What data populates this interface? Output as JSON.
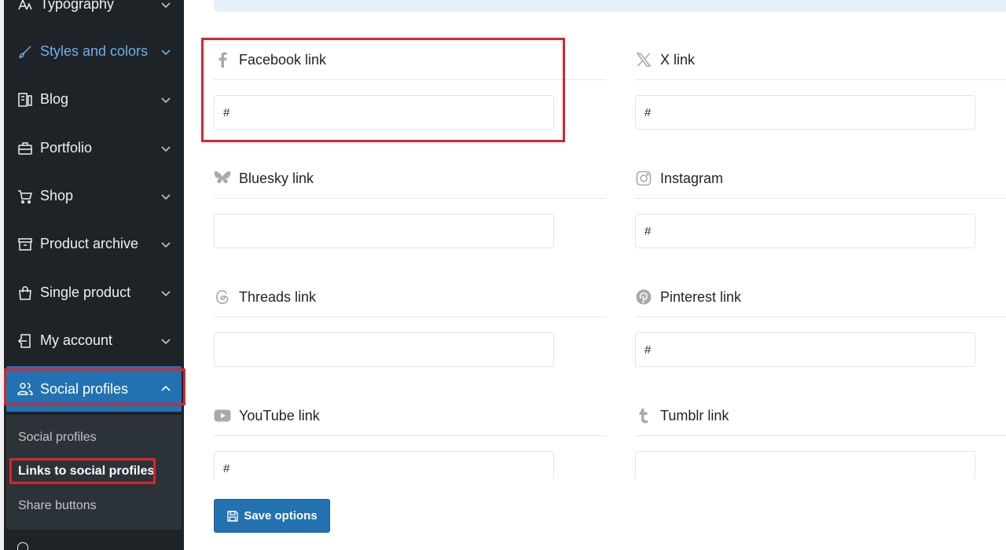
{
  "sidebar": {
    "items": [
      {
        "label": "Typography",
        "icon": "typography-icon"
      },
      {
        "label": "Styles and colors",
        "icon": "brush-icon"
      },
      {
        "label": "Blog",
        "icon": "blog-icon"
      },
      {
        "label": "Portfolio",
        "icon": "briefcase-icon"
      },
      {
        "label": "Shop",
        "icon": "cart-icon"
      },
      {
        "label": "Product archive",
        "icon": "archive-icon"
      },
      {
        "label": "Single product",
        "icon": "bag-icon"
      },
      {
        "label": "My account",
        "icon": "login-icon"
      },
      {
        "label": "Social profiles",
        "icon": "users-icon"
      }
    ],
    "submenu": [
      {
        "label": "Social profiles"
      },
      {
        "label": "Links to social profiles"
      },
      {
        "label": "Share buttons"
      }
    ]
  },
  "fields": [
    {
      "label": "Facebook link",
      "icon": "facebook-icon",
      "value": "#"
    },
    {
      "label": "X link",
      "icon": "x-icon",
      "value": "#"
    },
    {
      "label": "Bluesky link",
      "icon": "bluesky-icon",
      "value": ""
    },
    {
      "label": "Instagram",
      "icon": "instagram-icon",
      "value": "#"
    },
    {
      "label": "Threads link",
      "icon": "threads-icon",
      "value": ""
    },
    {
      "label": "Pinterest link",
      "icon": "pinterest-icon",
      "value": "#"
    },
    {
      "label": "YouTube link",
      "icon": "youtube-icon",
      "value": "#"
    },
    {
      "label": "Tumblr link",
      "icon": "tumblr-icon",
      "value": ""
    }
  ],
  "actions": {
    "save_label": "Save options"
  },
  "colors": {
    "accent": "#2271b1",
    "highlight": "#d7262e",
    "sidebar_bg": "#1d2327",
    "active_link": "#72aee6"
  }
}
